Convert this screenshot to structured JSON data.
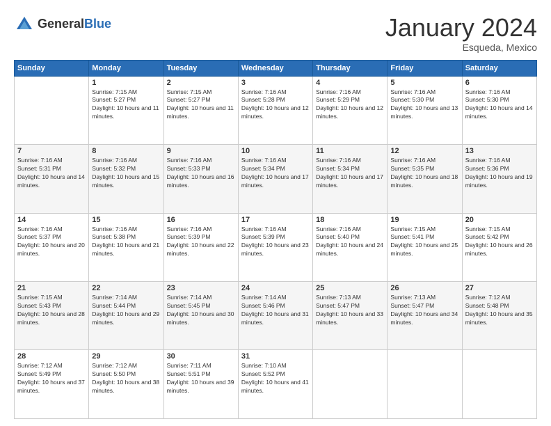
{
  "header": {
    "logo_general": "General",
    "logo_blue": "Blue",
    "month_title": "January 2024",
    "location": "Esqueda, Mexico"
  },
  "days_of_week": [
    "Sunday",
    "Monday",
    "Tuesday",
    "Wednesday",
    "Thursday",
    "Friday",
    "Saturday"
  ],
  "weeks": [
    [
      {
        "day": "",
        "sunrise": "",
        "sunset": "",
        "daylight": "",
        "empty": true
      },
      {
        "day": "1",
        "sunrise": "Sunrise: 7:15 AM",
        "sunset": "Sunset: 5:27 PM",
        "daylight": "Daylight: 10 hours and 11 minutes."
      },
      {
        "day": "2",
        "sunrise": "Sunrise: 7:15 AM",
        "sunset": "Sunset: 5:27 PM",
        "daylight": "Daylight: 10 hours and 11 minutes."
      },
      {
        "day": "3",
        "sunrise": "Sunrise: 7:16 AM",
        "sunset": "Sunset: 5:28 PM",
        "daylight": "Daylight: 10 hours and 12 minutes."
      },
      {
        "day": "4",
        "sunrise": "Sunrise: 7:16 AM",
        "sunset": "Sunset: 5:29 PM",
        "daylight": "Daylight: 10 hours and 12 minutes."
      },
      {
        "day": "5",
        "sunrise": "Sunrise: 7:16 AM",
        "sunset": "Sunset: 5:30 PM",
        "daylight": "Daylight: 10 hours and 13 minutes."
      },
      {
        "day": "6",
        "sunrise": "Sunrise: 7:16 AM",
        "sunset": "Sunset: 5:30 PM",
        "daylight": "Daylight: 10 hours and 14 minutes."
      }
    ],
    [
      {
        "day": "7",
        "sunrise": "Sunrise: 7:16 AM",
        "sunset": "Sunset: 5:31 PM",
        "daylight": "Daylight: 10 hours and 14 minutes."
      },
      {
        "day": "8",
        "sunrise": "Sunrise: 7:16 AM",
        "sunset": "Sunset: 5:32 PM",
        "daylight": "Daylight: 10 hours and 15 minutes."
      },
      {
        "day": "9",
        "sunrise": "Sunrise: 7:16 AM",
        "sunset": "Sunset: 5:33 PM",
        "daylight": "Daylight: 10 hours and 16 minutes."
      },
      {
        "day": "10",
        "sunrise": "Sunrise: 7:16 AM",
        "sunset": "Sunset: 5:34 PM",
        "daylight": "Daylight: 10 hours and 17 minutes."
      },
      {
        "day": "11",
        "sunrise": "Sunrise: 7:16 AM",
        "sunset": "Sunset: 5:34 PM",
        "daylight": "Daylight: 10 hours and 17 minutes."
      },
      {
        "day": "12",
        "sunrise": "Sunrise: 7:16 AM",
        "sunset": "Sunset: 5:35 PM",
        "daylight": "Daylight: 10 hours and 18 minutes."
      },
      {
        "day": "13",
        "sunrise": "Sunrise: 7:16 AM",
        "sunset": "Sunset: 5:36 PM",
        "daylight": "Daylight: 10 hours and 19 minutes."
      }
    ],
    [
      {
        "day": "14",
        "sunrise": "Sunrise: 7:16 AM",
        "sunset": "Sunset: 5:37 PM",
        "daylight": "Daylight: 10 hours and 20 minutes."
      },
      {
        "day": "15",
        "sunrise": "Sunrise: 7:16 AM",
        "sunset": "Sunset: 5:38 PM",
        "daylight": "Daylight: 10 hours and 21 minutes."
      },
      {
        "day": "16",
        "sunrise": "Sunrise: 7:16 AM",
        "sunset": "Sunset: 5:39 PM",
        "daylight": "Daylight: 10 hours and 22 minutes."
      },
      {
        "day": "17",
        "sunrise": "Sunrise: 7:16 AM",
        "sunset": "Sunset: 5:39 PM",
        "daylight": "Daylight: 10 hours and 23 minutes."
      },
      {
        "day": "18",
        "sunrise": "Sunrise: 7:16 AM",
        "sunset": "Sunset: 5:40 PM",
        "daylight": "Daylight: 10 hours and 24 minutes."
      },
      {
        "day": "19",
        "sunrise": "Sunrise: 7:15 AM",
        "sunset": "Sunset: 5:41 PM",
        "daylight": "Daylight: 10 hours and 25 minutes."
      },
      {
        "day": "20",
        "sunrise": "Sunrise: 7:15 AM",
        "sunset": "Sunset: 5:42 PM",
        "daylight": "Daylight: 10 hours and 26 minutes."
      }
    ],
    [
      {
        "day": "21",
        "sunrise": "Sunrise: 7:15 AM",
        "sunset": "Sunset: 5:43 PM",
        "daylight": "Daylight: 10 hours and 28 minutes."
      },
      {
        "day": "22",
        "sunrise": "Sunrise: 7:14 AM",
        "sunset": "Sunset: 5:44 PM",
        "daylight": "Daylight: 10 hours and 29 minutes."
      },
      {
        "day": "23",
        "sunrise": "Sunrise: 7:14 AM",
        "sunset": "Sunset: 5:45 PM",
        "daylight": "Daylight: 10 hours and 30 minutes."
      },
      {
        "day": "24",
        "sunrise": "Sunrise: 7:14 AM",
        "sunset": "Sunset: 5:46 PM",
        "daylight": "Daylight: 10 hours and 31 minutes."
      },
      {
        "day": "25",
        "sunrise": "Sunrise: 7:13 AM",
        "sunset": "Sunset: 5:47 PM",
        "daylight": "Daylight: 10 hours and 33 minutes."
      },
      {
        "day": "26",
        "sunrise": "Sunrise: 7:13 AM",
        "sunset": "Sunset: 5:47 PM",
        "daylight": "Daylight: 10 hours and 34 minutes."
      },
      {
        "day": "27",
        "sunrise": "Sunrise: 7:12 AM",
        "sunset": "Sunset: 5:48 PM",
        "daylight": "Daylight: 10 hours and 35 minutes."
      }
    ],
    [
      {
        "day": "28",
        "sunrise": "Sunrise: 7:12 AM",
        "sunset": "Sunset: 5:49 PM",
        "daylight": "Daylight: 10 hours and 37 minutes."
      },
      {
        "day": "29",
        "sunrise": "Sunrise: 7:12 AM",
        "sunset": "Sunset: 5:50 PM",
        "daylight": "Daylight: 10 hours and 38 minutes."
      },
      {
        "day": "30",
        "sunrise": "Sunrise: 7:11 AM",
        "sunset": "Sunset: 5:51 PM",
        "daylight": "Daylight: 10 hours and 39 minutes."
      },
      {
        "day": "31",
        "sunrise": "Sunrise: 7:10 AM",
        "sunset": "Sunset: 5:52 PM",
        "daylight": "Daylight: 10 hours and 41 minutes."
      },
      {
        "day": "",
        "sunrise": "",
        "sunset": "",
        "daylight": "",
        "empty": true
      },
      {
        "day": "",
        "sunrise": "",
        "sunset": "",
        "daylight": "",
        "empty": true
      },
      {
        "day": "",
        "sunrise": "",
        "sunset": "",
        "daylight": "",
        "empty": true
      }
    ]
  ]
}
